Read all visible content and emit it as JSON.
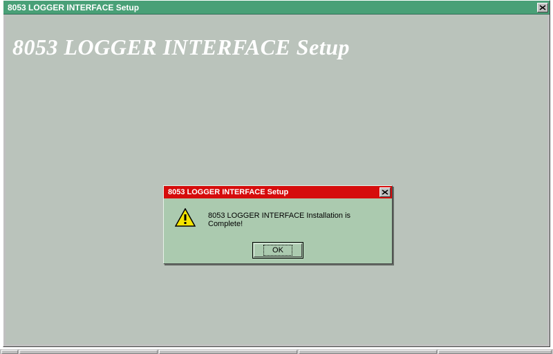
{
  "mainWindow": {
    "title": "8053 LOGGER INTERFACE Setup",
    "heading": "8053 LOGGER INTERFACE Setup"
  },
  "dialog": {
    "title": "8053 LOGGER INTERFACE Setup",
    "message": "8053 LOGGER INTERFACE Installation is Complete!",
    "okLabel": "OK"
  }
}
